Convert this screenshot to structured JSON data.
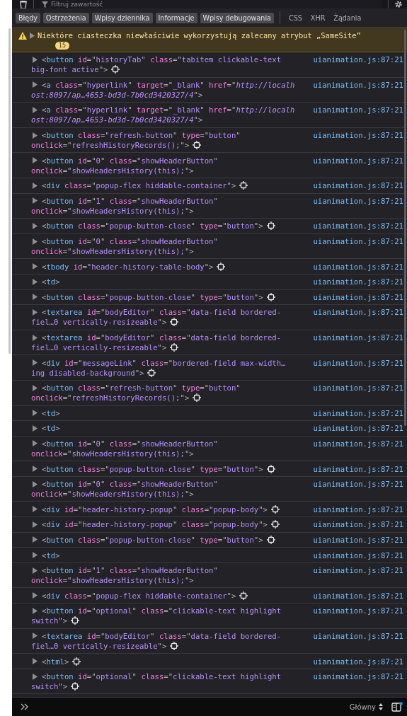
{
  "toolbar": {
    "filter": {
      "placeholder": "Filtruj zawartość"
    }
  },
  "filters": [
    {
      "label": "Błędy",
      "selected": true
    },
    {
      "label": "Ostrzeżenia",
      "selected": true
    },
    {
      "label": "Wpisy dziennika",
      "selected": true
    },
    {
      "label": "Informacje",
      "selected": true
    },
    {
      "label": "Wpisy debugowania",
      "selected": true
    },
    {
      "label": "CSS",
      "selected": false
    },
    {
      "label": "XHR",
      "selected": false
    },
    {
      "label": "Żądania",
      "selected": false
    }
  ],
  "warning": {
    "text": "Niektóre ciasteczka niewłaściwie wykorzystują zalecany atrybut „SameSite”",
    "count": "15"
  },
  "messages": [
    {
      "lines": [
        [
          {
            "kind": "punct",
            "text": "<"
          },
          {
            "kind": "tag",
            "text": "button"
          },
          {
            "kind": "attr",
            "text": " id"
          },
          {
            "kind": "punct",
            "text": "=\""
          },
          {
            "kind": "value",
            "text": "historyTab"
          },
          {
            "kind": "punct",
            "text": "\""
          },
          {
            "kind": "attr",
            "text": " class"
          },
          {
            "kind": "punct",
            "text": "=\""
          },
          {
            "kind": "value",
            "text": "tabitem clickable-text"
          }
        ],
        [
          {
            "kind": "value",
            "text": "big-font active"
          },
          {
            "kind": "punct",
            "text": "\">"
          }
        ]
      ],
      "inspect_icon": true,
      "source": "uianimation.js:87:21"
    },
    {
      "lines": [
        [
          {
            "kind": "punct",
            "text": "<"
          },
          {
            "kind": "tag",
            "text": "a"
          },
          {
            "kind": "attr",
            "text": " class"
          },
          {
            "kind": "punct",
            "text": "=\""
          },
          {
            "kind": "value",
            "text": "hyperlink"
          },
          {
            "kind": "punct",
            "text": "\""
          },
          {
            "kind": "attr",
            "text": " target"
          },
          {
            "kind": "punct",
            "text": "=\""
          },
          {
            "kind": "value",
            "text": "_blank"
          },
          {
            "kind": "punct",
            "text": "\""
          },
          {
            "kind": "attr",
            "text": " href"
          },
          {
            "kind": "punct",
            "text": "=\""
          },
          {
            "kind": "url",
            "text": "http://localh"
          }
        ],
        [
          {
            "kind": "url",
            "text": "ost:8097/ap…4653-bd3d-7b0cd3420327/4"
          },
          {
            "kind": "punct",
            "text": "\">"
          }
        ]
      ],
      "inspect_icon": false,
      "source": "uianimation.js:87:21"
    },
    {
      "lines": [
        [
          {
            "kind": "punct",
            "text": "<"
          },
          {
            "kind": "tag",
            "text": "a"
          },
          {
            "kind": "attr",
            "text": " class"
          },
          {
            "kind": "punct",
            "text": "=\""
          },
          {
            "kind": "value",
            "text": "hyperlink"
          },
          {
            "kind": "punct",
            "text": "\""
          },
          {
            "kind": "attr",
            "text": " target"
          },
          {
            "kind": "punct",
            "text": "=\""
          },
          {
            "kind": "value",
            "text": "_blank"
          },
          {
            "kind": "punct",
            "text": "\""
          },
          {
            "kind": "attr",
            "text": " href"
          },
          {
            "kind": "punct",
            "text": "=\""
          },
          {
            "kind": "url",
            "text": "http://localh"
          }
        ],
        [
          {
            "kind": "url",
            "text": "ost:8097/ap…4653-bd3d-7b0cd3420327/4"
          },
          {
            "kind": "punct",
            "text": "\">"
          }
        ]
      ],
      "inspect_icon": false,
      "source": "uianimation.js:87:21"
    },
    {
      "lines": [
        [
          {
            "kind": "punct",
            "text": "<"
          },
          {
            "kind": "tag",
            "text": "button"
          },
          {
            "kind": "attr",
            "text": " class"
          },
          {
            "kind": "punct",
            "text": "=\""
          },
          {
            "kind": "value",
            "text": "refresh-button"
          },
          {
            "kind": "punct",
            "text": "\""
          },
          {
            "kind": "attr",
            "text": " type"
          },
          {
            "kind": "punct",
            "text": "=\""
          },
          {
            "kind": "value",
            "text": "button"
          },
          {
            "kind": "punct",
            "text": "\""
          }
        ],
        [
          {
            "kind": "attr",
            "text": "onclick"
          },
          {
            "kind": "punct",
            "text": "=\""
          },
          {
            "kind": "value",
            "text": "refreshHistoryRecords();"
          },
          {
            "kind": "punct",
            "text": "\">"
          }
        ]
      ],
      "inspect_icon": true,
      "source": "uianimation.js:87:21"
    },
    {
      "lines": [
        [
          {
            "kind": "punct",
            "text": "<"
          },
          {
            "kind": "tag",
            "text": "button"
          },
          {
            "kind": "attr",
            "text": " id"
          },
          {
            "kind": "punct",
            "text": "=\""
          },
          {
            "kind": "value",
            "text": "0"
          },
          {
            "kind": "punct",
            "text": "\""
          },
          {
            "kind": "attr",
            "text": " class"
          },
          {
            "kind": "punct",
            "text": "=\""
          },
          {
            "kind": "value",
            "text": "showHeaderButton"
          },
          {
            "kind": "punct",
            "text": "\""
          }
        ],
        [
          {
            "kind": "attr",
            "text": "onclick"
          },
          {
            "kind": "punct",
            "text": "=\""
          },
          {
            "kind": "value",
            "text": "showHeadersHistory(this);"
          },
          {
            "kind": "punct",
            "text": "\">"
          }
        ]
      ],
      "inspect_icon": false,
      "source": "uianimation.js:87:21"
    },
    {
      "lines": [
        [
          {
            "kind": "punct",
            "text": "<"
          },
          {
            "kind": "tag",
            "text": "div"
          },
          {
            "kind": "attr",
            "text": " class"
          },
          {
            "kind": "punct",
            "text": "=\""
          },
          {
            "kind": "value",
            "text": "popup-flex hiddable-container"
          },
          {
            "kind": "punct",
            "text": "\">"
          }
        ]
      ],
      "inspect_icon": true,
      "source": "uianimation.js:87:21"
    },
    {
      "lines": [
        [
          {
            "kind": "punct",
            "text": "<"
          },
          {
            "kind": "tag",
            "text": "button"
          },
          {
            "kind": "attr",
            "text": " id"
          },
          {
            "kind": "punct",
            "text": "=\""
          },
          {
            "kind": "value",
            "text": "1"
          },
          {
            "kind": "punct",
            "text": "\""
          },
          {
            "kind": "attr",
            "text": " class"
          },
          {
            "kind": "punct",
            "text": "=\""
          },
          {
            "kind": "value",
            "text": "showHeaderButton"
          },
          {
            "kind": "punct",
            "text": "\""
          }
        ],
        [
          {
            "kind": "attr",
            "text": "onclick"
          },
          {
            "kind": "punct",
            "text": "=\""
          },
          {
            "kind": "value",
            "text": "showHeadersHistory(this);"
          },
          {
            "kind": "punct",
            "text": "\">"
          }
        ]
      ],
      "inspect_icon": false,
      "source": "uianimation.js:87:21"
    },
    {
      "lines": [
        [
          {
            "kind": "punct",
            "text": "<"
          },
          {
            "kind": "tag",
            "text": "button"
          },
          {
            "kind": "attr",
            "text": " class"
          },
          {
            "kind": "punct",
            "text": "=\""
          },
          {
            "kind": "value",
            "text": "popup-button-close"
          },
          {
            "kind": "punct",
            "text": "\""
          },
          {
            "kind": "attr",
            "text": " type"
          },
          {
            "kind": "punct",
            "text": "=\""
          },
          {
            "kind": "value",
            "text": "button"
          },
          {
            "kind": "punct",
            "text": "\">"
          }
        ]
      ],
      "inspect_icon": true,
      "source": "uianimation.js:87:21"
    },
    {
      "lines": [
        [
          {
            "kind": "punct",
            "text": "<"
          },
          {
            "kind": "tag",
            "text": "button"
          },
          {
            "kind": "attr",
            "text": " id"
          },
          {
            "kind": "punct",
            "text": "=\""
          },
          {
            "kind": "value",
            "text": "0"
          },
          {
            "kind": "punct",
            "text": "\""
          },
          {
            "kind": "attr",
            "text": " class"
          },
          {
            "kind": "punct",
            "text": "=\""
          },
          {
            "kind": "value",
            "text": "showHeaderButton"
          },
          {
            "kind": "punct",
            "text": "\""
          }
        ],
        [
          {
            "kind": "attr",
            "text": "onclick"
          },
          {
            "kind": "punct",
            "text": "=\""
          },
          {
            "kind": "value",
            "text": "showHeadersHistory(this);"
          },
          {
            "kind": "punct",
            "text": "\">"
          }
        ]
      ],
      "inspect_icon": false,
      "source": "uianimation.js:87:21"
    },
    {
      "lines": [
        [
          {
            "kind": "punct",
            "text": "<"
          },
          {
            "kind": "tag",
            "text": "tbody"
          },
          {
            "kind": "attr",
            "text": " id"
          },
          {
            "kind": "punct",
            "text": "=\""
          },
          {
            "kind": "value",
            "text": "header-history-table-body"
          },
          {
            "kind": "punct",
            "text": "\">"
          }
        ]
      ],
      "inspect_icon": true,
      "source": "uianimation.js:87:21"
    },
    {
      "lines": [
        [
          {
            "kind": "punct",
            "text": "<"
          },
          {
            "kind": "tag",
            "text": "td"
          },
          {
            "kind": "punct",
            "text": ">"
          }
        ]
      ],
      "inspect_icon": false,
      "source": "uianimation.js:87:21"
    },
    {
      "lines": [
        [
          {
            "kind": "punct",
            "text": "<"
          },
          {
            "kind": "tag",
            "text": "button"
          },
          {
            "kind": "attr",
            "text": " class"
          },
          {
            "kind": "punct",
            "text": "=\""
          },
          {
            "kind": "value",
            "text": "popup-button-close"
          },
          {
            "kind": "punct",
            "text": "\""
          },
          {
            "kind": "attr",
            "text": " type"
          },
          {
            "kind": "punct",
            "text": "=\""
          },
          {
            "kind": "value",
            "text": "button"
          },
          {
            "kind": "punct",
            "text": "\">"
          }
        ]
      ],
      "inspect_icon": true,
      "source": "uianimation.js:87:21"
    },
    {
      "lines": [
        [
          {
            "kind": "punct",
            "text": "<"
          },
          {
            "kind": "tag",
            "text": "textarea"
          },
          {
            "kind": "attr",
            "text": " id"
          },
          {
            "kind": "punct",
            "text": "=\""
          },
          {
            "kind": "value",
            "text": "bodyEditor"
          },
          {
            "kind": "punct",
            "text": "\""
          },
          {
            "kind": "attr",
            "text": " class"
          },
          {
            "kind": "punct",
            "text": "=\""
          },
          {
            "kind": "value",
            "text": "data-field bordered-"
          }
        ],
        [
          {
            "kind": "value",
            "text": "fiel…0 vertically-resizeable"
          },
          {
            "kind": "punct",
            "text": "\">"
          }
        ]
      ],
      "inspect_icon": true,
      "source": "uianimation.js:87:21"
    },
    {
      "lines": [
        [
          {
            "kind": "punct",
            "text": "<"
          },
          {
            "kind": "tag",
            "text": "textarea"
          },
          {
            "kind": "attr",
            "text": " id"
          },
          {
            "kind": "punct",
            "text": "=\""
          },
          {
            "kind": "value",
            "text": "bodyEditor"
          },
          {
            "kind": "punct",
            "text": "\""
          },
          {
            "kind": "attr",
            "text": " class"
          },
          {
            "kind": "punct",
            "text": "=\""
          },
          {
            "kind": "value",
            "text": "data-field bordered-"
          }
        ],
        [
          {
            "kind": "value",
            "text": "fiel…0 vertically-resizeable"
          },
          {
            "kind": "punct",
            "text": "\">"
          }
        ]
      ],
      "inspect_icon": true,
      "source": "uianimation.js:87:21"
    },
    {
      "lines": [
        [
          {
            "kind": "punct",
            "text": "<"
          },
          {
            "kind": "tag",
            "text": "div"
          },
          {
            "kind": "attr",
            "text": " id"
          },
          {
            "kind": "punct",
            "text": "=\""
          },
          {
            "kind": "value",
            "text": "messageLink"
          },
          {
            "kind": "punct",
            "text": "\""
          },
          {
            "kind": "attr",
            "text": " class"
          },
          {
            "kind": "punct",
            "text": "=\""
          },
          {
            "kind": "value",
            "text": "bordered-field max-width…"
          }
        ],
        [
          {
            "kind": "value",
            "text": "ing disabled-background"
          },
          {
            "kind": "punct",
            "text": "\">"
          }
        ]
      ],
      "inspect_icon": true,
      "source": "uianimation.js:87:21"
    },
    {
      "lines": [
        [
          {
            "kind": "punct",
            "text": "<"
          },
          {
            "kind": "tag",
            "text": "button"
          },
          {
            "kind": "attr",
            "text": " class"
          },
          {
            "kind": "punct",
            "text": "=\""
          },
          {
            "kind": "value",
            "text": "refresh-button"
          },
          {
            "kind": "punct",
            "text": "\""
          },
          {
            "kind": "attr",
            "text": " type"
          },
          {
            "kind": "punct",
            "text": "=\""
          },
          {
            "kind": "value",
            "text": "button"
          },
          {
            "kind": "punct",
            "text": "\""
          }
        ],
        [
          {
            "kind": "attr",
            "text": "onclick"
          },
          {
            "kind": "punct",
            "text": "=\""
          },
          {
            "kind": "value",
            "text": "refreshHistoryRecords();"
          },
          {
            "kind": "punct",
            "text": "\">"
          }
        ]
      ],
      "inspect_icon": true,
      "source": "uianimation.js:87:21"
    },
    {
      "lines": [
        [
          {
            "kind": "punct",
            "text": "<"
          },
          {
            "kind": "tag",
            "text": "td"
          },
          {
            "kind": "punct",
            "text": ">"
          }
        ]
      ],
      "inspect_icon": false,
      "source": "uianimation.js:87:21"
    },
    {
      "lines": [
        [
          {
            "kind": "punct",
            "text": "<"
          },
          {
            "kind": "tag",
            "text": "td"
          },
          {
            "kind": "punct",
            "text": ">"
          }
        ]
      ],
      "inspect_icon": false,
      "source": "uianimation.js:87:21"
    },
    {
      "lines": [
        [
          {
            "kind": "punct",
            "text": "<"
          },
          {
            "kind": "tag",
            "text": "button"
          },
          {
            "kind": "attr",
            "text": " id"
          },
          {
            "kind": "punct",
            "text": "=\""
          },
          {
            "kind": "value",
            "text": "0"
          },
          {
            "kind": "punct",
            "text": "\""
          },
          {
            "kind": "attr",
            "text": " class"
          },
          {
            "kind": "punct",
            "text": "=\""
          },
          {
            "kind": "value",
            "text": "showHeaderButton"
          },
          {
            "kind": "punct",
            "text": "\""
          }
        ],
        [
          {
            "kind": "attr",
            "text": "onclick"
          },
          {
            "kind": "punct",
            "text": "=\""
          },
          {
            "kind": "value",
            "text": "showHeadersHistory(this);"
          },
          {
            "kind": "punct",
            "text": "\">"
          }
        ]
      ],
      "inspect_icon": false,
      "source": "uianimation.js:87:21"
    },
    {
      "lines": [
        [
          {
            "kind": "punct",
            "text": "<"
          },
          {
            "kind": "tag",
            "text": "button"
          },
          {
            "kind": "attr",
            "text": " class"
          },
          {
            "kind": "punct",
            "text": "=\""
          },
          {
            "kind": "value",
            "text": "popup-button-close"
          },
          {
            "kind": "punct",
            "text": "\""
          },
          {
            "kind": "attr",
            "text": " type"
          },
          {
            "kind": "punct",
            "text": "=\""
          },
          {
            "kind": "value",
            "text": "button"
          },
          {
            "kind": "punct",
            "text": "\">"
          }
        ]
      ],
      "inspect_icon": true,
      "source": "uianimation.js:87:21"
    },
    {
      "lines": [
        [
          {
            "kind": "punct",
            "text": "<"
          },
          {
            "kind": "tag",
            "text": "button"
          },
          {
            "kind": "attr",
            "text": " id"
          },
          {
            "kind": "punct",
            "text": "=\""
          },
          {
            "kind": "value",
            "text": "0"
          },
          {
            "kind": "punct",
            "text": "\""
          },
          {
            "kind": "attr",
            "text": " class"
          },
          {
            "kind": "punct",
            "text": "=\""
          },
          {
            "kind": "value",
            "text": "showHeaderButton"
          },
          {
            "kind": "punct",
            "text": "\""
          }
        ],
        [
          {
            "kind": "attr",
            "text": "onclick"
          },
          {
            "kind": "punct",
            "text": "=\""
          },
          {
            "kind": "value",
            "text": "showHeadersHistory(this);"
          },
          {
            "kind": "punct",
            "text": "\">"
          }
        ]
      ],
      "inspect_icon": false,
      "source": "uianimation.js:87:21"
    },
    {
      "lines": [
        [
          {
            "kind": "punct",
            "text": "<"
          },
          {
            "kind": "tag",
            "text": "div"
          },
          {
            "kind": "attr",
            "text": " id"
          },
          {
            "kind": "punct",
            "text": "=\""
          },
          {
            "kind": "value",
            "text": "header-history-popup"
          },
          {
            "kind": "punct",
            "text": "\""
          },
          {
            "kind": "attr",
            "text": " class"
          },
          {
            "kind": "punct",
            "text": "=\""
          },
          {
            "kind": "value",
            "text": "popup-body"
          },
          {
            "kind": "punct",
            "text": "\">"
          }
        ]
      ],
      "inspect_icon": true,
      "source": "uianimation.js:87:21"
    },
    {
      "lines": [
        [
          {
            "kind": "punct",
            "text": "<"
          },
          {
            "kind": "tag",
            "text": "div"
          },
          {
            "kind": "attr",
            "text": " id"
          },
          {
            "kind": "punct",
            "text": "=\""
          },
          {
            "kind": "value",
            "text": "header-history-popup"
          },
          {
            "kind": "punct",
            "text": "\""
          },
          {
            "kind": "attr",
            "text": " class"
          },
          {
            "kind": "punct",
            "text": "=\""
          },
          {
            "kind": "value",
            "text": "popup-body"
          },
          {
            "kind": "punct",
            "text": "\">"
          }
        ]
      ],
      "inspect_icon": true,
      "source": "uianimation.js:87:21"
    },
    {
      "lines": [
        [
          {
            "kind": "punct",
            "text": "<"
          },
          {
            "kind": "tag",
            "text": "button"
          },
          {
            "kind": "attr",
            "text": " class"
          },
          {
            "kind": "punct",
            "text": "=\""
          },
          {
            "kind": "value",
            "text": "popup-button-close"
          },
          {
            "kind": "punct",
            "text": "\""
          },
          {
            "kind": "attr",
            "text": " type"
          },
          {
            "kind": "punct",
            "text": "=\""
          },
          {
            "kind": "value",
            "text": "button"
          },
          {
            "kind": "punct",
            "text": "\">"
          }
        ]
      ],
      "inspect_icon": true,
      "source": "uianimation.js:87:21"
    },
    {
      "lines": [
        [
          {
            "kind": "punct",
            "text": "<"
          },
          {
            "kind": "tag",
            "text": "td"
          },
          {
            "kind": "punct",
            "text": ">"
          }
        ]
      ],
      "inspect_icon": false,
      "source": "uianimation.js:87:21"
    },
    {
      "lines": [
        [
          {
            "kind": "punct",
            "text": "<"
          },
          {
            "kind": "tag",
            "text": "button"
          },
          {
            "kind": "attr",
            "text": " id"
          },
          {
            "kind": "punct",
            "text": "=\""
          },
          {
            "kind": "value",
            "text": "1"
          },
          {
            "kind": "punct",
            "text": "\""
          },
          {
            "kind": "attr",
            "text": " class"
          },
          {
            "kind": "punct",
            "text": "=\""
          },
          {
            "kind": "value",
            "text": "showHeaderButton"
          },
          {
            "kind": "punct",
            "text": "\""
          }
        ],
        [
          {
            "kind": "attr",
            "text": "onclick"
          },
          {
            "kind": "punct",
            "text": "=\""
          },
          {
            "kind": "value",
            "text": "showHeadersHistory(this);"
          },
          {
            "kind": "punct",
            "text": "\">"
          }
        ]
      ],
      "inspect_icon": false,
      "source": "uianimation.js:87:21"
    },
    {
      "lines": [
        [
          {
            "kind": "punct",
            "text": "<"
          },
          {
            "kind": "tag",
            "text": "div"
          },
          {
            "kind": "attr",
            "text": " class"
          },
          {
            "kind": "punct",
            "text": "=\""
          },
          {
            "kind": "value",
            "text": "popup-flex hiddable-container"
          },
          {
            "kind": "punct",
            "text": "\">"
          }
        ]
      ],
      "inspect_icon": true,
      "source": "uianimation.js:87:21"
    },
    {
      "lines": [
        [
          {
            "kind": "punct",
            "text": "<"
          },
          {
            "kind": "tag",
            "text": "button"
          },
          {
            "kind": "attr",
            "text": " id"
          },
          {
            "kind": "punct",
            "text": "=\""
          },
          {
            "kind": "value",
            "text": "optional"
          },
          {
            "kind": "punct",
            "text": "\""
          },
          {
            "kind": "attr",
            "text": " class"
          },
          {
            "kind": "punct",
            "text": "=\""
          },
          {
            "kind": "value",
            "text": "clickable-text highlight"
          }
        ],
        [
          {
            "kind": "value",
            "text": "switch"
          },
          {
            "kind": "punct",
            "text": "\">"
          }
        ]
      ],
      "inspect_icon": true,
      "source": "uianimation.js:87:21"
    },
    {
      "lines": [
        [
          {
            "kind": "punct",
            "text": "<"
          },
          {
            "kind": "tag",
            "text": "textarea"
          },
          {
            "kind": "attr",
            "text": " id"
          },
          {
            "kind": "punct",
            "text": "=\""
          },
          {
            "kind": "value",
            "text": "bodyEditor"
          },
          {
            "kind": "punct",
            "text": "\""
          },
          {
            "kind": "attr",
            "text": " class"
          },
          {
            "kind": "punct",
            "text": "=\""
          },
          {
            "kind": "value",
            "text": "data-field bordered-"
          }
        ],
        [
          {
            "kind": "value",
            "text": "fiel…0 vertically-resizeable"
          },
          {
            "kind": "punct",
            "text": "\">"
          }
        ]
      ],
      "inspect_icon": true,
      "source": "uianimation.js:87:21"
    },
    {
      "lines": [
        [
          {
            "kind": "punct",
            "text": "<"
          },
          {
            "kind": "tag",
            "text": "html"
          },
          {
            "kind": "punct",
            "text": ">"
          }
        ]
      ],
      "inspect_icon": true,
      "source": "uianimation.js:87:21"
    },
    {
      "lines": [
        [
          {
            "kind": "punct",
            "text": "<"
          },
          {
            "kind": "tag",
            "text": "button"
          },
          {
            "kind": "attr",
            "text": " id"
          },
          {
            "kind": "punct",
            "text": "=\""
          },
          {
            "kind": "value",
            "text": "optional"
          },
          {
            "kind": "punct",
            "text": "\""
          },
          {
            "kind": "attr",
            "text": " class"
          },
          {
            "kind": "punct",
            "text": "=\""
          },
          {
            "kind": "value",
            "text": "clickable-text highlight"
          }
        ],
        [
          {
            "kind": "value",
            "text": "switch"
          },
          {
            "kind": "punct",
            "text": "\">"
          }
        ]
      ],
      "inspect_icon": true,
      "source": "uianimation.js:87:21"
    }
  ],
  "input_bar": {
    "context": "Główny"
  }
}
